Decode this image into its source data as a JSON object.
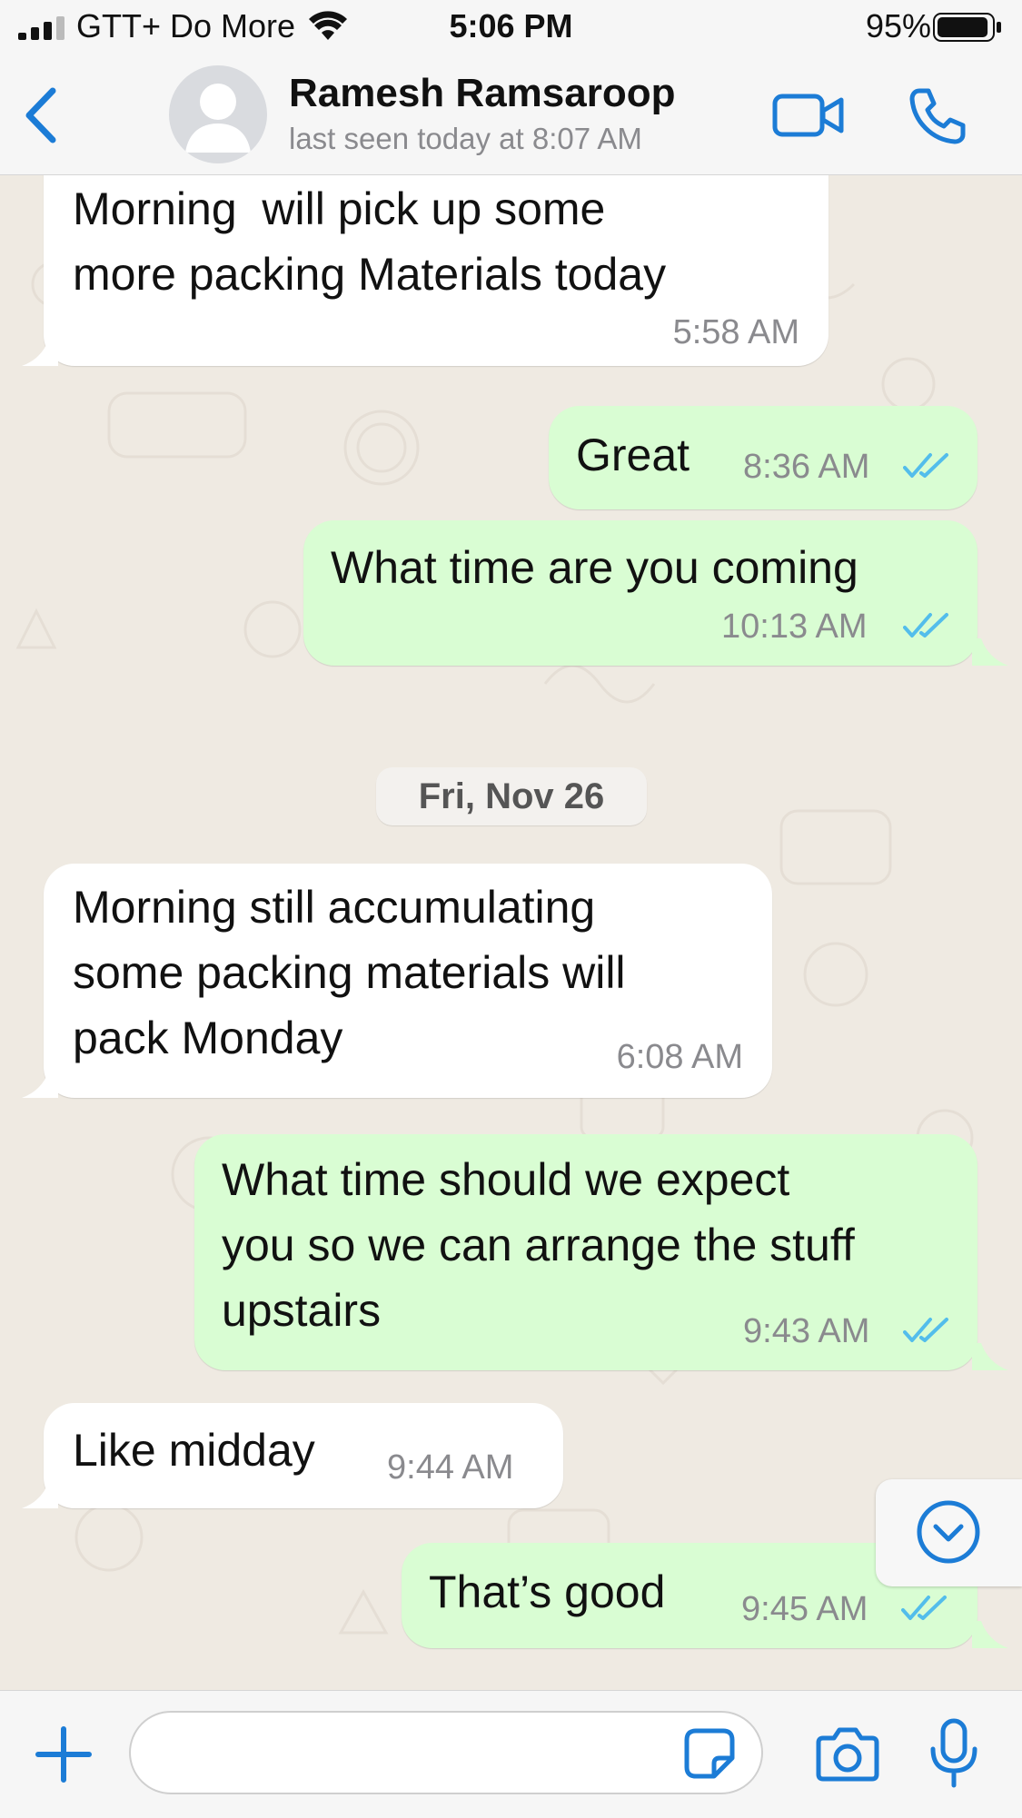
{
  "status_bar": {
    "carrier": "GTT+ Do More",
    "time": "5:06 PM",
    "battery_percent": "95%",
    "battery_level": 0.95
  },
  "header": {
    "contact_name": "Ramesh Ramsaroop",
    "last_seen": "last seen today at 8:07 AM"
  },
  "date_separator": "Fri, Nov 26",
  "messages": [
    {
      "direction": "incoming",
      "lines": [
        "Morning  will pick up some",
        "more packing Materials today"
      ],
      "time": "5:58 AM"
    },
    {
      "direction": "outgoing",
      "lines": [
        "Great"
      ],
      "time": "8:36 AM",
      "status": "read"
    },
    {
      "direction": "outgoing",
      "lines": [
        "What time are you coming"
      ],
      "time": "10:13 AM",
      "status": "read"
    },
    {
      "direction": "incoming",
      "lines": [
        "Morning still accumulating",
        "some packing materials will",
        "pack Monday"
      ],
      "time": "6:08 AM"
    },
    {
      "direction": "outgoing",
      "lines": [
        "What time should we expect",
        "you so we can arrange the stuff",
        "upstairs"
      ],
      "time": "9:43 AM",
      "status": "read"
    },
    {
      "direction": "incoming",
      "lines": [
        "Like midday"
      ],
      "time": "9:44 AM"
    },
    {
      "direction": "outgoing",
      "lines": [
        "That’s good"
      ],
      "time": "9:45 AM",
      "status": "read"
    }
  ],
  "input": {
    "placeholder": ""
  },
  "colors": {
    "accent": "#1c7cd6",
    "read_ticks": "#53bdeb",
    "incoming_bubble": "#ffffff",
    "outgoing_bubble": "#d9fdd3",
    "chat_background": "#efeae2"
  },
  "icons": {
    "back": "chevron-left-icon",
    "video": "video-camera-icon",
    "call": "phone-icon",
    "scroll_down": "chevron-down-circle-icon",
    "attach": "plus-icon",
    "sticker": "sticker-icon",
    "camera": "camera-icon",
    "mic": "microphone-icon"
  }
}
